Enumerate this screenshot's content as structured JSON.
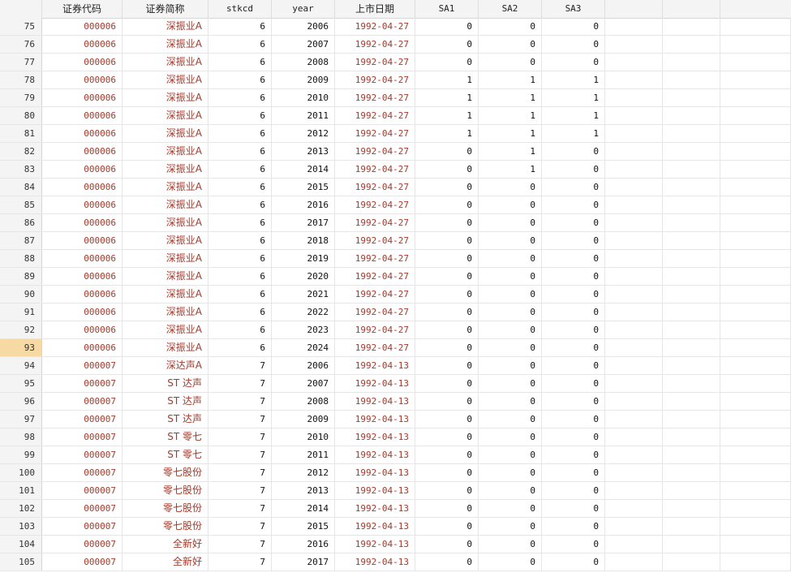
{
  "columns": [
    {
      "key": "code",
      "label": "证券代码"
    },
    {
      "key": "name",
      "label": "证券简称"
    },
    {
      "key": "stkcd",
      "label": "stkcd"
    },
    {
      "key": "year",
      "label": "year"
    },
    {
      "key": "listdate",
      "label": "上市日期"
    },
    {
      "key": "sa1",
      "label": "SA1"
    },
    {
      "key": "sa2",
      "label": "SA2"
    },
    {
      "key": "sa3",
      "label": "SA3"
    }
  ],
  "selected_row": "93",
  "rows": [
    {
      "n": "75",
      "code": "000006",
      "name": "深振业A",
      "stkcd": "6",
      "year": "2006",
      "listdate": "1992-04-27",
      "sa1": "0",
      "sa2": "0",
      "sa3": "0"
    },
    {
      "n": "76",
      "code": "000006",
      "name": "深振业A",
      "stkcd": "6",
      "year": "2007",
      "listdate": "1992-04-27",
      "sa1": "0",
      "sa2": "0",
      "sa3": "0"
    },
    {
      "n": "77",
      "code": "000006",
      "name": "深振业A",
      "stkcd": "6",
      "year": "2008",
      "listdate": "1992-04-27",
      "sa1": "0",
      "sa2": "0",
      "sa3": "0"
    },
    {
      "n": "78",
      "code": "000006",
      "name": "深振业A",
      "stkcd": "6",
      "year": "2009",
      "listdate": "1992-04-27",
      "sa1": "1",
      "sa2": "1",
      "sa3": "1"
    },
    {
      "n": "79",
      "code": "000006",
      "name": "深振业A",
      "stkcd": "6",
      "year": "2010",
      "listdate": "1992-04-27",
      "sa1": "1",
      "sa2": "1",
      "sa3": "1"
    },
    {
      "n": "80",
      "code": "000006",
      "name": "深振业A",
      "stkcd": "6",
      "year": "2011",
      "listdate": "1992-04-27",
      "sa1": "1",
      "sa2": "1",
      "sa3": "1"
    },
    {
      "n": "81",
      "code": "000006",
      "name": "深振业A",
      "stkcd": "6",
      "year": "2012",
      "listdate": "1992-04-27",
      "sa1": "1",
      "sa2": "1",
      "sa3": "1"
    },
    {
      "n": "82",
      "code": "000006",
      "name": "深振业A",
      "stkcd": "6",
      "year": "2013",
      "listdate": "1992-04-27",
      "sa1": "0",
      "sa2": "1",
      "sa3": "0"
    },
    {
      "n": "83",
      "code": "000006",
      "name": "深振业A",
      "stkcd": "6",
      "year": "2014",
      "listdate": "1992-04-27",
      "sa1": "0",
      "sa2": "1",
      "sa3": "0"
    },
    {
      "n": "84",
      "code": "000006",
      "name": "深振业A",
      "stkcd": "6",
      "year": "2015",
      "listdate": "1992-04-27",
      "sa1": "0",
      "sa2": "0",
      "sa3": "0"
    },
    {
      "n": "85",
      "code": "000006",
      "name": "深振业A",
      "stkcd": "6",
      "year": "2016",
      "listdate": "1992-04-27",
      "sa1": "0",
      "sa2": "0",
      "sa3": "0"
    },
    {
      "n": "86",
      "code": "000006",
      "name": "深振业A",
      "stkcd": "6",
      "year": "2017",
      "listdate": "1992-04-27",
      "sa1": "0",
      "sa2": "0",
      "sa3": "0"
    },
    {
      "n": "87",
      "code": "000006",
      "name": "深振业A",
      "stkcd": "6",
      "year": "2018",
      "listdate": "1992-04-27",
      "sa1": "0",
      "sa2": "0",
      "sa3": "0"
    },
    {
      "n": "88",
      "code": "000006",
      "name": "深振业A",
      "stkcd": "6",
      "year": "2019",
      "listdate": "1992-04-27",
      "sa1": "0",
      "sa2": "0",
      "sa3": "0"
    },
    {
      "n": "89",
      "code": "000006",
      "name": "深振业A",
      "stkcd": "6",
      "year": "2020",
      "listdate": "1992-04-27",
      "sa1": "0",
      "sa2": "0",
      "sa3": "0"
    },
    {
      "n": "90",
      "code": "000006",
      "name": "深振业A",
      "stkcd": "6",
      "year": "2021",
      "listdate": "1992-04-27",
      "sa1": "0",
      "sa2": "0",
      "sa3": "0"
    },
    {
      "n": "91",
      "code": "000006",
      "name": "深振业A",
      "stkcd": "6",
      "year": "2022",
      "listdate": "1992-04-27",
      "sa1": "0",
      "sa2": "0",
      "sa3": "0"
    },
    {
      "n": "92",
      "code": "000006",
      "name": "深振业A",
      "stkcd": "6",
      "year": "2023",
      "listdate": "1992-04-27",
      "sa1": "0",
      "sa2": "0",
      "sa3": "0"
    },
    {
      "n": "93",
      "code": "000006",
      "name": "深振业A",
      "stkcd": "6",
      "year": "2024",
      "listdate": "1992-04-27",
      "sa1": "0",
      "sa2": "0",
      "sa3": "0"
    },
    {
      "n": "94",
      "code": "000007",
      "name": "深达声A",
      "stkcd": "7",
      "year": "2006",
      "listdate": "1992-04-13",
      "sa1": "0",
      "sa2": "0",
      "sa3": "0"
    },
    {
      "n": "95",
      "code": "000007",
      "name": "ST 达声",
      "stkcd": "7",
      "year": "2007",
      "listdate": "1992-04-13",
      "sa1": "0",
      "sa2": "0",
      "sa3": "0"
    },
    {
      "n": "96",
      "code": "000007",
      "name": "ST 达声",
      "stkcd": "7",
      "year": "2008",
      "listdate": "1992-04-13",
      "sa1": "0",
      "sa2": "0",
      "sa3": "0"
    },
    {
      "n": "97",
      "code": "000007",
      "name": "ST 达声",
      "stkcd": "7",
      "year": "2009",
      "listdate": "1992-04-13",
      "sa1": "0",
      "sa2": "0",
      "sa3": "0"
    },
    {
      "n": "98",
      "code": "000007",
      "name": "ST 零七",
      "stkcd": "7",
      "year": "2010",
      "listdate": "1992-04-13",
      "sa1": "0",
      "sa2": "0",
      "sa3": "0"
    },
    {
      "n": "99",
      "code": "000007",
      "name": "ST 零七",
      "stkcd": "7",
      "year": "2011",
      "listdate": "1992-04-13",
      "sa1": "0",
      "sa2": "0",
      "sa3": "0"
    },
    {
      "n": "100",
      "code": "000007",
      "name": "零七股份",
      "stkcd": "7",
      "year": "2012",
      "listdate": "1992-04-13",
      "sa1": "0",
      "sa2": "0",
      "sa3": "0"
    },
    {
      "n": "101",
      "code": "000007",
      "name": "零七股份",
      "stkcd": "7",
      "year": "2013",
      "listdate": "1992-04-13",
      "sa1": "0",
      "sa2": "0",
      "sa3": "0"
    },
    {
      "n": "102",
      "code": "000007",
      "name": "零七股份",
      "stkcd": "7",
      "year": "2014",
      "listdate": "1992-04-13",
      "sa1": "0",
      "sa2": "0",
      "sa3": "0"
    },
    {
      "n": "103",
      "code": "000007",
      "name": "零七股份",
      "stkcd": "7",
      "year": "2015",
      "listdate": "1992-04-13",
      "sa1": "0",
      "sa2": "0",
      "sa3": "0"
    },
    {
      "n": "104",
      "code": "000007",
      "name": "全新好",
      "stkcd": "7",
      "year": "2016",
      "listdate": "1992-04-13",
      "sa1": "0",
      "sa2": "0",
      "sa3": "0"
    },
    {
      "n": "105",
      "code": "000007",
      "name": "全新好",
      "stkcd": "7",
      "year": "2017",
      "listdate": "1992-04-13",
      "sa1": "0",
      "sa2": "0",
      "sa3": "0"
    }
  ]
}
